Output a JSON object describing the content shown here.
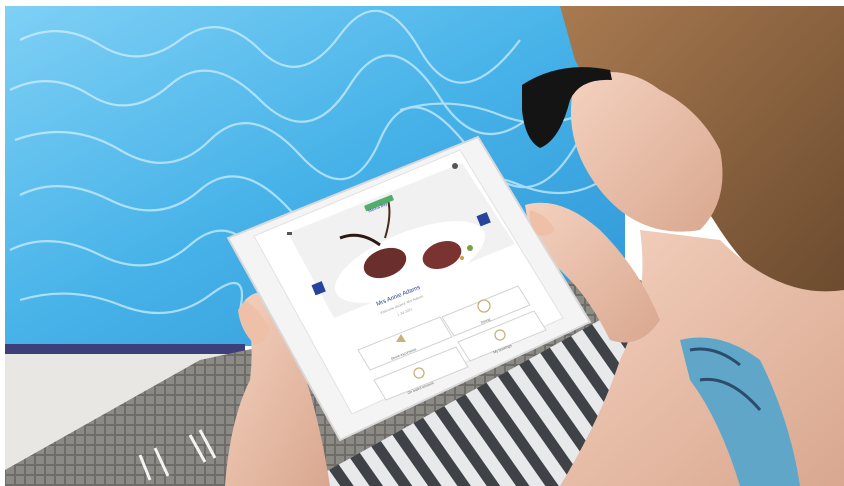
{
  "app": {
    "logo_text": "Marina Bay",
    "guest_name": "Mrs Annie Adams",
    "guest_subtitle": "Welcome aboard, Mrs Adams",
    "date_text": "1 Jul 2021"
  },
  "tiles": [
    {
      "label": "Dining",
      "icon": "plate-icon"
    },
    {
      "label": "Shore excursions",
      "icon": "landscape-icon"
    },
    {
      "label": "My bookings",
      "icon": "clock-icon"
    },
    {
      "label": "On board account",
      "icon": "wallet-icon"
    }
  ],
  "colors": {
    "pool": "#4fb8ea",
    "brand_blue": "#27439a",
    "towel_stripe": "#3f4348"
  }
}
